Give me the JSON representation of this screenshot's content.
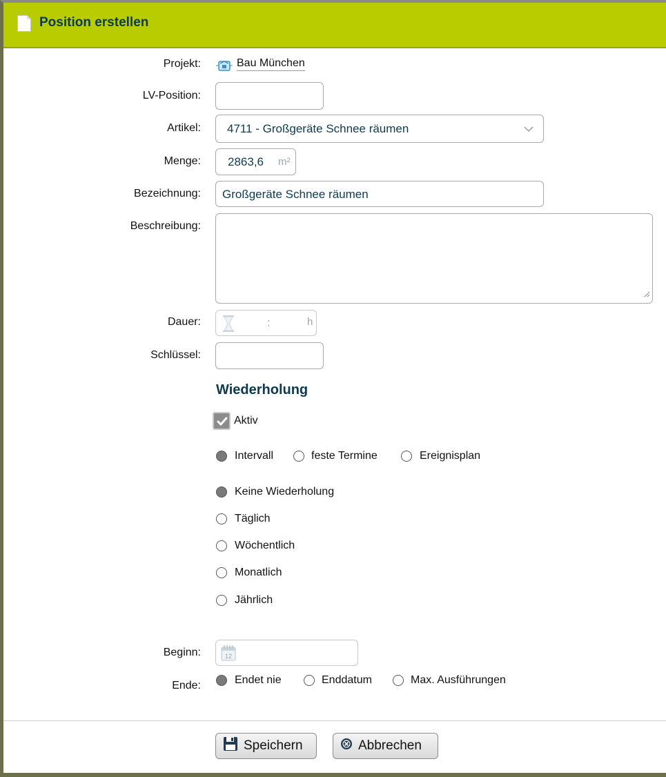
{
  "window": {
    "title": "Position erstellen"
  },
  "form": {
    "projekt_label": "Projekt:",
    "projekt_value": "Bau München",
    "lv_position_label": "LV-Position:",
    "lv_position_value": "",
    "artikel_label": "Artikel:",
    "artikel_value": "4711 - Großgeräte Schnee räumen",
    "menge_label": "Menge:",
    "menge_value": "2863,6",
    "menge_unit": "m²",
    "bezeichnung_label": "Bezeichnung:",
    "bezeichnung_value": "Großgeräte Schnee räumen",
    "beschreibung_label": "Beschreibung:",
    "beschreibung_value": "",
    "dauer_label": "Dauer:",
    "dauer_separator": ":",
    "dauer_unit": "h",
    "schluessel_label": "Schlüssel:",
    "schluessel_value": ""
  },
  "wiederholung": {
    "title": "Wiederholung",
    "aktiv_label": "Aktiv",
    "aktiv_checked": true,
    "mode_options": [
      "Intervall",
      "feste Termine",
      "Ereignisplan"
    ],
    "mode_selected": "Intervall",
    "interval_options": [
      "Keine Wiederholung",
      "Täglich",
      "Wöchentlich",
      "Monatlich",
      "Jährlich"
    ],
    "interval_selected": "Keine Wiederholung",
    "beginn_label": "Beginn:",
    "beginn_value": "",
    "ende_label": "Ende:",
    "ende_options": [
      "Endet nie",
      "Enddatum",
      "Max. Ausführungen"
    ],
    "ende_selected": "Endet nie"
  },
  "buttons": {
    "save_label": "Speichern",
    "cancel_label": "Abbrechen"
  },
  "colors": {
    "titlebar": "#b9cc00",
    "accent_text": "#0c3b50"
  }
}
